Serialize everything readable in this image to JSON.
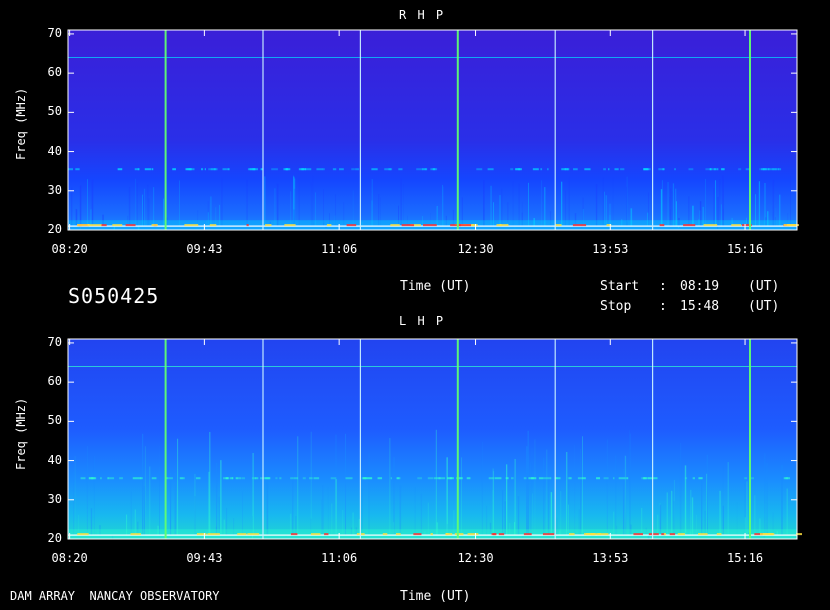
{
  "header": {
    "rhp_title": "R H P",
    "lhp_title": "L H P",
    "time_label_top": "Time (UT)",
    "time_label_bottom": "Time (UT)",
    "date_code": "S050425",
    "start_label": "Start",
    "start_colon": ":",
    "start_value": "08:19",
    "start_unit": "(UT)",
    "stop_label": "Stop",
    "stop_colon": ":",
    "stop_value": "15:48",
    "stop_unit": "(UT)",
    "footer_left": "DAM ARRAY  NANCAY OBSERVATORY"
  },
  "chart_data": [
    {
      "type": "heatmap",
      "title": "R H P",
      "xlabel": "Time (UT)",
      "ylabel": "Freq (MHz)",
      "x_ticks": [
        "08:20",
        "09:43",
        "11:06",
        "12:30",
        "13:53",
        "15:16"
      ],
      "y_ticks": [
        20,
        30,
        40,
        50,
        60,
        70
      ],
      "ylim": [
        20,
        71
      ],
      "xlim": [
        "08:19",
        "15:48"
      ],
      "colors": {
        "background": "#3a1fd8",
        "mid": "#1a3cff",
        "high": "#00e0ff",
        "burst": "#ffffff"
      }
    },
    {
      "type": "heatmap",
      "title": "L H P",
      "xlabel": "Time (UT)",
      "ylabel": "Freq (MHz)",
      "x_ticks": [
        "08:20",
        "09:43",
        "11:06",
        "12:30",
        "13:53",
        "15:16"
      ],
      "y_ticks": [
        20,
        30,
        40,
        50,
        60,
        70
      ],
      "ylim": [
        20,
        71
      ],
      "xlim": [
        "08:19",
        "15:48"
      ],
      "colors": {
        "background": "#2244f0",
        "mid": "#1a8cff",
        "high": "#2fffd0",
        "burst": "#ffffff"
      }
    }
  ],
  "ylabel_text": "Freq (MHz)"
}
